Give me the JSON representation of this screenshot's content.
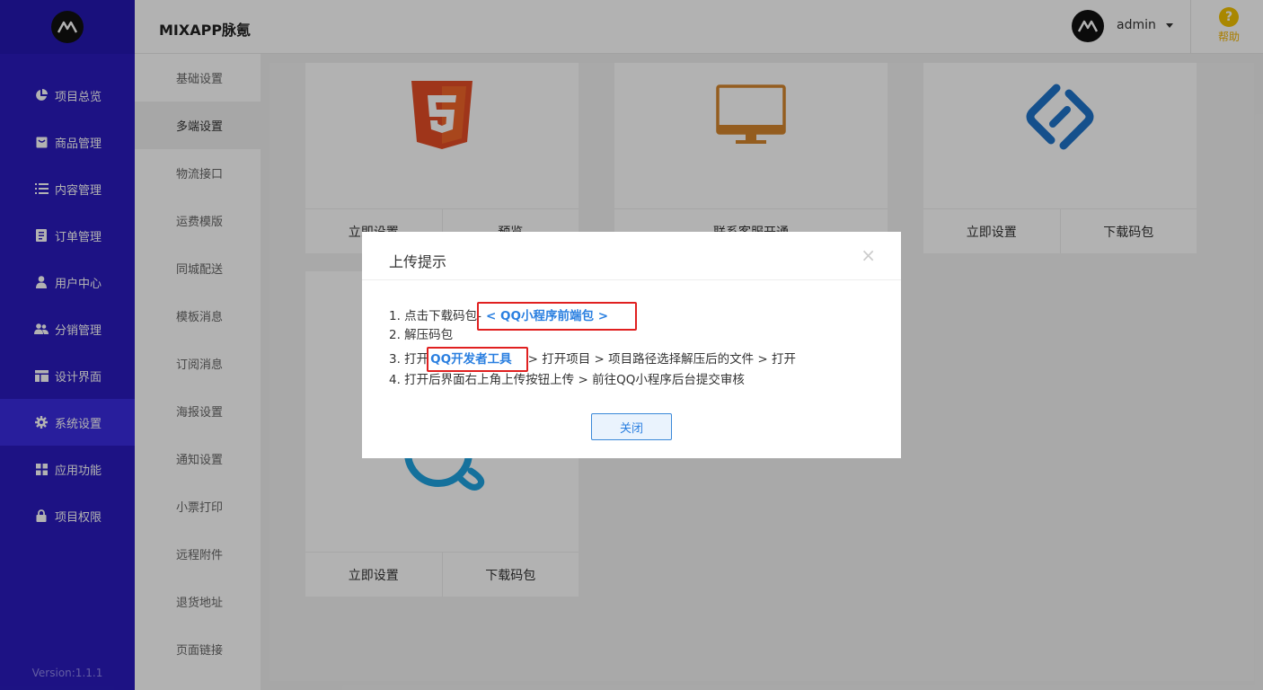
{
  "app": {
    "title": "MIXAPP脉氪"
  },
  "sidebar": {
    "version": "Version:1.1.1",
    "items": [
      {
        "label": "项目总览",
        "icon": "pie-chart-icon"
      },
      {
        "label": "商品管理",
        "icon": "product-icon"
      },
      {
        "label": "内容管理",
        "icon": "list-icon"
      },
      {
        "label": "订单管理",
        "icon": "order-icon"
      },
      {
        "label": "用户中心",
        "icon": "user-icon"
      },
      {
        "label": "分销管理",
        "icon": "users-icon"
      },
      {
        "label": "设计界面",
        "icon": "layout-icon"
      },
      {
        "label": "系统设置",
        "icon": "gear-icon",
        "active": true
      },
      {
        "label": "应用功能",
        "icon": "grid-icon"
      },
      {
        "label": "项目权限",
        "icon": "lock-icon"
      }
    ]
  },
  "header": {
    "user": "admin",
    "help": "帮助"
  },
  "submenu": {
    "items": [
      "基础设置",
      "多端设置",
      "物流接口",
      "运费模版",
      "同城配送",
      "模板消息",
      "订阅消息",
      "海报设置",
      "通知设置",
      "小票打印",
      "远程附件",
      "退货地址",
      "页面链接"
    ],
    "active_index": 1
  },
  "cards": {
    "h5": {
      "actions": [
        "立即设置",
        "预览"
      ]
    },
    "pc": {
      "actions": [
        "联系客服开通"
      ]
    },
    "link": {
      "actions": [
        "立即设置",
        "下载码包"
      ]
    },
    "qq": {
      "actions": [
        "立即设置",
        "下载码包"
      ]
    }
  },
  "modal": {
    "title": "上传提示",
    "step1_prefix": "1. 点击下载码包-",
    "step1_link": "< QQ小程序前端包 >",
    "step2": "2. 解压码包",
    "step3_prefix": "3. 打开",
    "step3_link": "QQ开发者工具",
    "step3_suffix": "> 打开项目 > 项目路径选择解压后的文件 > 打开",
    "step4": "4. 打开后界面右上角上传按钮上传 > 前往QQ小程序后台提交审核",
    "close_label": "关闭",
    "close_icon": "×"
  },
  "colors": {
    "sidebar": "#2a1bbd",
    "accent": "#2a7fe0",
    "highlight": "#e02020"
  }
}
